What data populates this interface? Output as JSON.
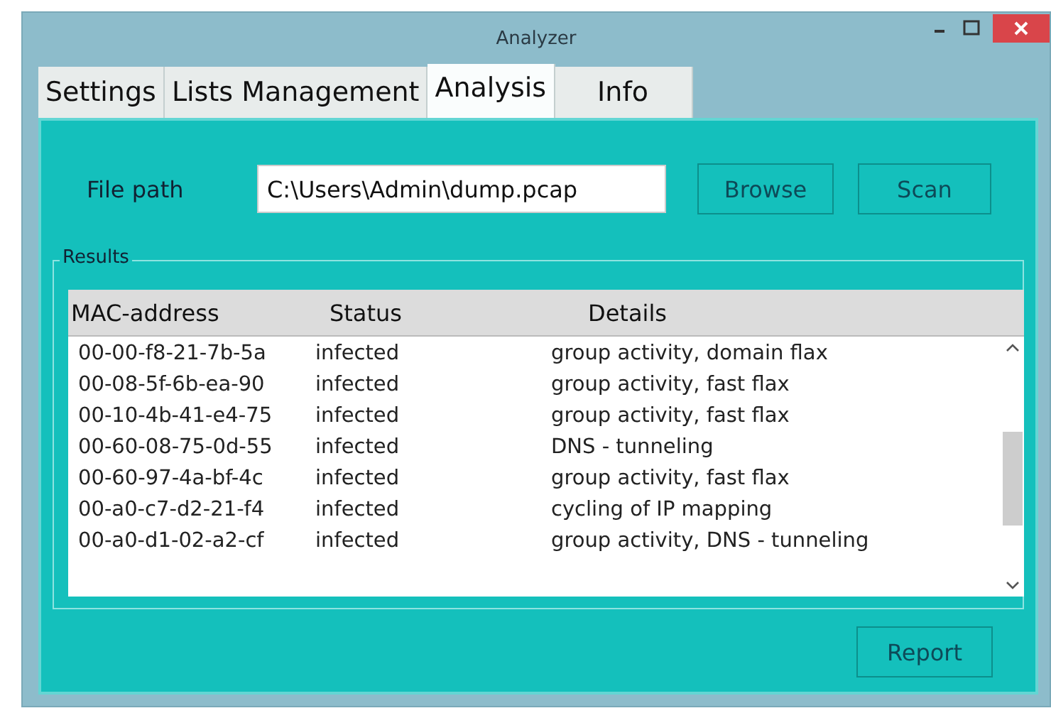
{
  "window": {
    "title": "Analyzer"
  },
  "tabs": [
    {
      "label": "Settings",
      "selected": false
    },
    {
      "label": "Lists Management",
      "selected": false
    },
    {
      "label": "Analysis",
      "selected": true
    },
    {
      "label": "Info",
      "selected": false
    }
  ],
  "file_path": {
    "label": "File path",
    "value": "C:\\Users\\Admin\\dump.pcap"
  },
  "buttons": [
    "Browse",
    "Scan"
  ],
  "results": {
    "title": "Results",
    "columns": [
      "MAC-address",
      "Status",
      "Details"
    ],
    "rows": [
      [
        "00-00-f8-21-7b-5a",
        "infected",
        "group activity, domain flax"
      ],
      [
        "00-08-5f-6b-ea-90",
        "infected",
        "group activity, fast flax"
      ],
      [
        "00-10-4b-41-e4-75",
        "infected",
        "group activity, fast flax"
      ],
      [
        "00-60-08-75-0d-55",
        "infected",
        "DNS - tunneling"
      ],
      [
        "00-60-97-4a-bf-4c",
        "infected",
        "group activity, fast flax"
      ],
      [
        "00-a0-c7-d2-21-f4",
        "infected",
        "cycling of IP mapping"
      ],
      [
        "00-a0-d1-02-a2-cf",
        "infected",
        "group activity, DNS - tunneling"
      ]
    ]
  },
  "report_button": "Report"
}
